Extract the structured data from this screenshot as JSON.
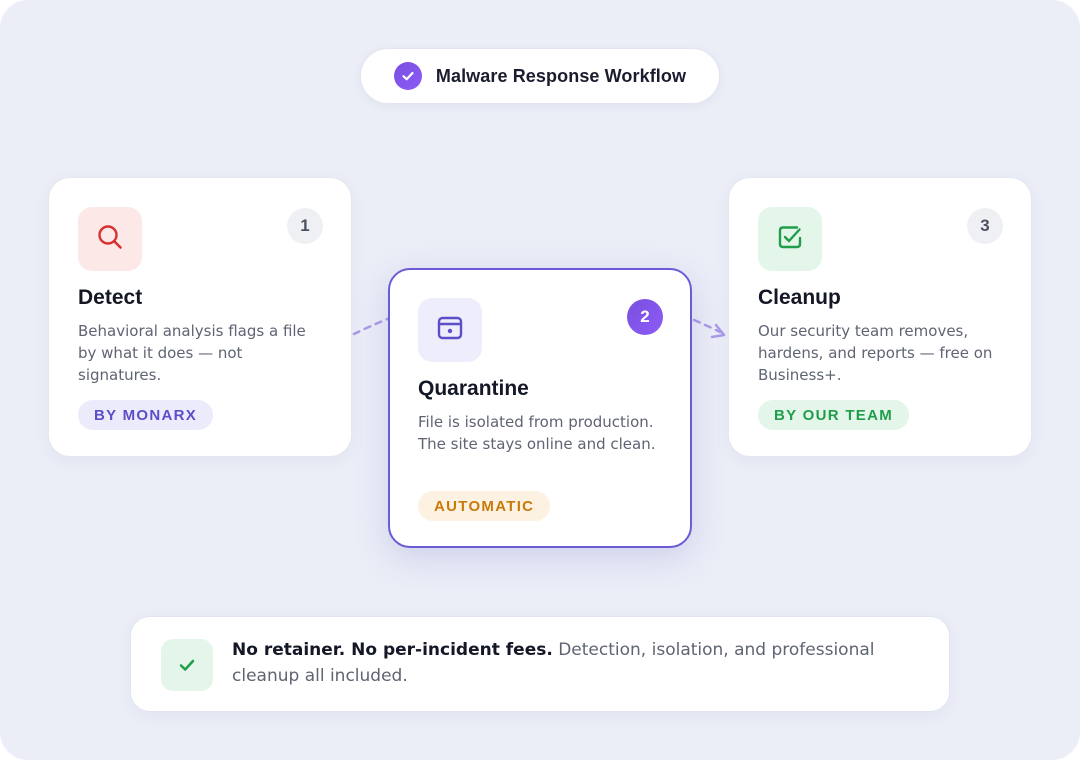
{
  "header": {
    "title": "Malware Response Workflow",
    "icon": "check-circle-icon"
  },
  "steps": [
    {
      "number": "1",
      "title": "Detect",
      "description": "Behavioral analysis flags a file by what it does — not signatures.",
      "badge": "BY MONARX",
      "icon": "search-icon",
      "icon_color": "#d93030",
      "icon_bg": "#fde8e8",
      "badge_bg": "#ecebfb",
      "badge_color": "#5b4fc9"
    },
    {
      "number": "2",
      "title": "Quarantine",
      "description": "File is isolated from production. The site stays online and clean.",
      "badge": "AUTOMATIC",
      "icon": "lockbox-icon",
      "icon_color": "#5b4fc9",
      "icon_bg": "#eeedfb",
      "badge_bg": "#fdf2e1",
      "badge_color": "#c77a0a",
      "highlighted": true
    },
    {
      "number": "3",
      "title": "Cleanup",
      "description": "Our security team removes, hardens, and reports — free on Business+.",
      "badge": "BY OUR TEAM",
      "icon": "checkbox-icon",
      "icon_color": "#1f9d4a",
      "icon_bg": "#e4f5e9",
      "badge_bg": "#e4f5e9",
      "badge_color": "#1f9d4a"
    }
  ],
  "footer": {
    "strong": "No retainer. No per-incident fees.",
    "text": " Detection, isolation, and professional cleanup all included.",
    "icon": "check-icon"
  },
  "colors": {
    "accent": "#6b5bd6",
    "background": "#ebeef7",
    "connector": "#a99be8"
  }
}
